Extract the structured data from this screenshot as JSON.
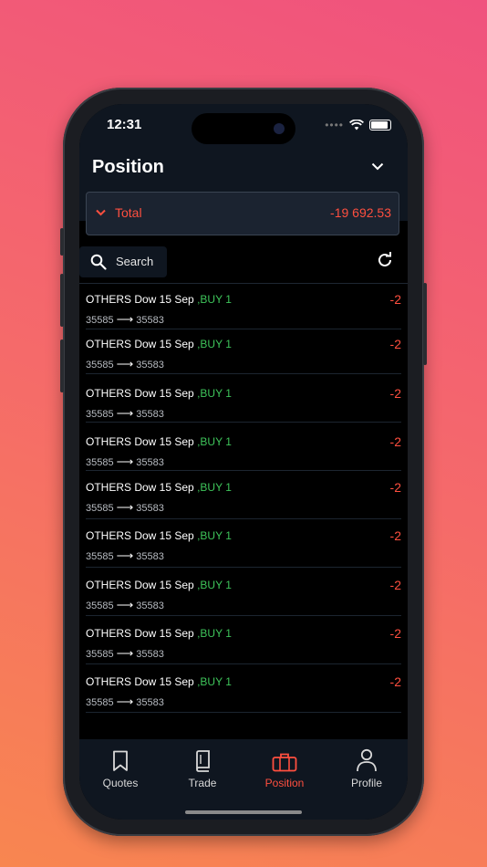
{
  "status": {
    "time": "12:31"
  },
  "header": {
    "title": "Position"
  },
  "total": {
    "label": "Total",
    "value": "-19 692.53"
  },
  "search": {
    "label": "Search"
  },
  "positions": [
    {
      "instrument": "OTHERS Dow 15 Sep",
      "side": ",BUY 1",
      "open": "35585",
      "current": "35583",
      "pl": "-2"
    },
    {
      "instrument": "OTHERS Dow 15 Sep",
      "side": ",BUY 1",
      "open": "35585",
      "current": "35583",
      "pl": "-2"
    },
    {
      "instrument": "OTHERS Dow 15 Sep",
      "side": ",BUY 1",
      "open": "35585",
      "current": "35583",
      "pl": "-2"
    },
    {
      "instrument": "OTHERS Dow 15 Sep",
      "side": ",BUY 1",
      "open": "35585",
      "current": "35583",
      "pl": "-2"
    },
    {
      "instrument": "OTHERS Dow 15 Sep",
      "side": ",BUY 1",
      "open": "35585",
      "current": "35583",
      "pl": "-2"
    },
    {
      "instrument": "OTHERS Dow 15 Sep",
      "side": ",BUY 1",
      "open": "35585",
      "current": "35583",
      "pl": "-2"
    },
    {
      "instrument": "OTHERS Dow 15 Sep",
      "side": ",BUY 1",
      "open": "35585",
      "current": "35583",
      "pl": "-2"
    },
    {
      "instrument": "OTHERS Dow 15 Sep",
      "side": ",BUY 1",
      "open": "35585",
      "current": "35583",
      "pl": "-2"
    },
    {
      "instrument": "OTHERS Dow 15 Sep",
      "side": ",BUY 1",
      "open": "35585",
      "current": "35583",
      "pl": "-2"
    }
  ],
  "tabs": [
    {
      "label": "Quotes",
      "icon": "bookmark-icon"
    },
    {
      "label": "Trade",
      "icon": "book-icon"
    },
    {
      "label": "Position",
      "icon": "briefcase-icon",
      "active": true
    },
    {
      "label": "Profile",
      "icon": "person-icon"
    }
  ],
  "colors": {
    "accent": "#ff4f3f",
    "buy": "#3ec45a",
    "panel": "#0f1620"
  }
}
